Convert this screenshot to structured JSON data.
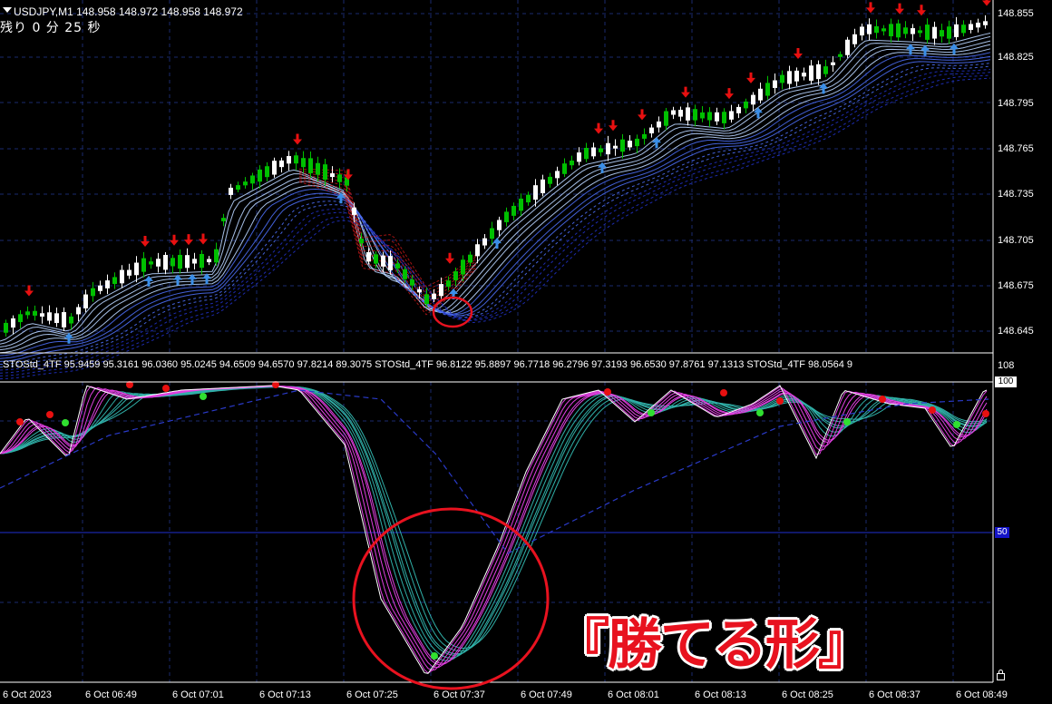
{
  "header": {
    "symbol_info": "USDJPY,M1  148.958 148.972 148.958 148.972",
    "countdown": "残り 0 分 25 秒"
  },
  "indicator": {
    "label": "STOStd_4TF 95.9459 95.3161 96.0360 95.0245 94.6509 94.6570 97.8214 89.3075   STOStd_4TF 96.8122 95.8897 96.7718 96.2796 97.3193 96.6530 97.8761 97.1313   STOStd_4TF 98.0564 9",
    "scale_top": "108",
    "level_100": "100",
    "level_50": "50"
  },
  "price_axis": [
    "148.855",
    "148.825",
    "148.795",
    "148.765",
    "148.735",
    "148.705",
    "148.675",
    "148.645"
  ],
  "time_axis": [
    "6 Oct 2023",
    "6 Oct 06:49",
    "6 Oct 07:01",
    "6 Oct 07:13",
    "6 Oct 07:25",
    "6 Oct 07:37",
    "6 Oct 07:49",
    "6 Oct 08:01",
    "6 Oct 08:13",
    "6 Oct 08:25",
    "6 Oct 08:37",
    "6 Oct 08:49"
  ],
  "caption": "『勝てる形』",
  "colors": {
    "background": "#000000",
    "grid": "#1a2a6e",
    "bull_candle": "#00c000",
    "bear_candle": "#ffffff",
    "buy_arrow": "#3a8ee8",
    "sell_arrow": "#e81010",
    "annotation": "#e8121f"
  },
  "icons": {
    "dropdown": "triangle-down-icon",
    "lock": "lock-icon"
  }
}
